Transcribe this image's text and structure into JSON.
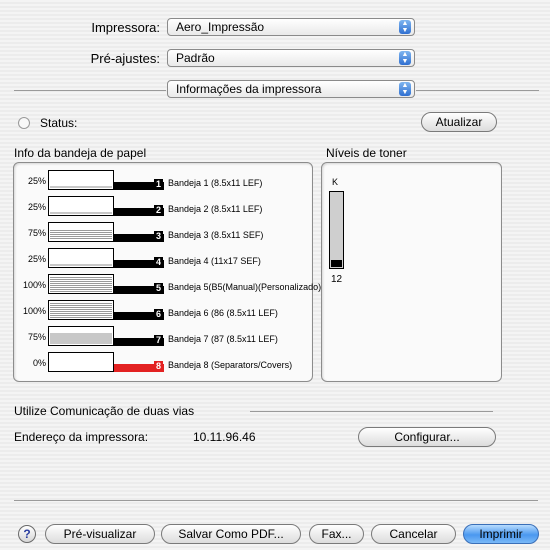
{
  "print": {
    "printer_label": "Impressora:",
    "printer_value": "Aero_Impressão",
    "presets_label": "Pré-ajustes:",
    "presets_value": "Padrão",
    "panel_value": "Informações da impressora"
  },
  "status": {
    "label": "Status:",
    "refresh_button": "Atualizar"
  },
  "trays": {
    "title": "Info da bandeja de papel",
    "items": [
      {
        "pct": "25%",
        "num": "1",
        "name": "Bandeja 1 (8.5x11 LEF)",
        "level": 0.25,
        "fill": "gray",
        "alert": false
      },
      {
        "pct": "25%",
        "num": "2",
        "name": "Bandeja 2 (8.5x11 LEF)",
        "level": 0.25,
        "fill": "gray",
        "alert": false
      },
      {
        "pct": "75%",
        "num": "3",
        "name": "Bandeja 3 (8.5x11 SEF)",
        "level": 0.75,
        "fill": "lines",
        "alert": false
      },
      {
        "pct": "25%",
        "num": "4",
        "name": "Bandeja 4 (11x17 SEF)",
        "level": 0.25,
        "fill": "gray",
        "alert": false
      },
      {
        "pct": "100%",
        "num": "5",
        "name": "Bandeja 5(B5(Manual)(Personalizado)",
        "level": 1.0,
        "fill": "lines",
        "alert": false
      },
      {
        "pct": "100%",
        "num": "6",
        "name": "Bandeja 6 (86 (8.5x11 LEF)",
        "level": 1.0,
        "fill": "lines",
        "alert": false
      },
      {
        "pct": "75%",
        "num": "7",
        "name": "Bandeja 7 (87 (8.5x11 LEF)",
        "level": 0.75,
        "fill": "gray",
        "alert": false
      },
      {
        "pct": "0%",
        "num": "8",
        "name": "Bandeja 8 (Separators/Covers)",
        "level": 0.0,
        "fill": "gray",
        "alert": true
      }
    ]
  },
  "toner": {
    "title": "Níveis de toner",
    "color_label": "K",
    "value": "12",
    "level": 0.12
  },
  "comm": {
    "title": "Utilize Comunicação de duas vias",
    "address_label": "Endereço da impressora:",
    "address_value": "10.11.96.46",
    "configure_button": "Configurar..."
  },
  "footer": {
    "help": "?",
    "preview": "Pré-visualizar",
    "save_pdf": "Salvar Como PDF...",
    "fax": "Fax...",
    "cancel": "Cancelar",
    "print": "Imprimir"
  },
  "colors": {
    "accent": "#4a98ef",
    "alert": "#e32222"
  }
}
